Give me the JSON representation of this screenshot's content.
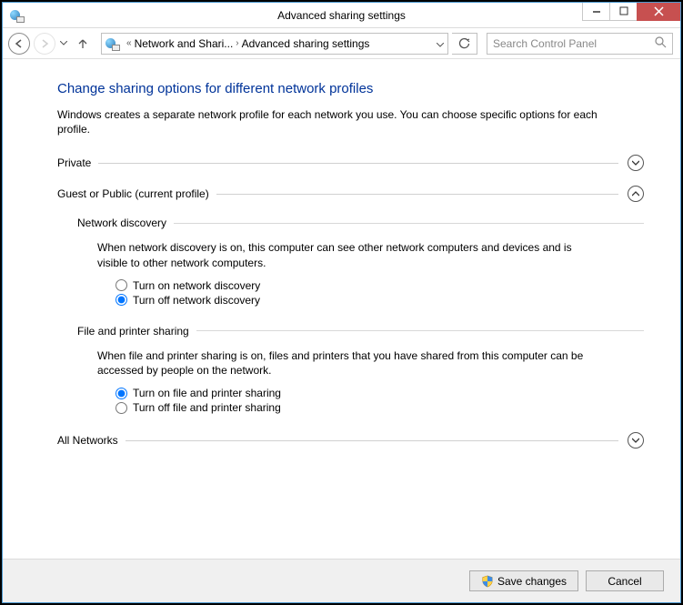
{
  "window": {
    "title": "Advanced sharing settings",
    "controls": {
      "min": "minimize",
      "max": "maximize",
      "close": "close"
    }
  },
  "breadcrumb": {
    "prefix": "«",
    "path1": "Network and Shari...",
    "path2": "Advanced sharing settings"
  },
  "search": {
    "placeholder": "Search Control Panel"
  },
  "heading": "Change sharing options for different network profiles",
  "intro": "Windows creates a separate network profile for each network you use. You can choose specific options for each profile.",
  "sections": {
    "private": {
      "label": "Private",
      "expanded": false
    },
    "guest": {
      "label": "Guest or Public (current profile)",
      "expanded": true,
      "net_discovery": {
        "title": "Network discovery",
        "desc": "When network discovery is on, this computer can see other network computers and devices and is visible to other network computers.",
        "opt_on": "Turn on network discovery",
        "opt_off": "Turn off network discovery",
        "selected": "off"
      },
      "file_share": {
        "title": "File and printer sharing",
        "desc": "When file and printer sharing is on, files and printers that you have shared from this computer can be accessed by people on the network.",
        "opt_on": "Turn on file and printer sharing",
        "opt_off": "Turn off file and printer sharing",
        "selected": "on"
      }
    },
    "all": {
      "label": "All Networks",
      "expanded": false
    }
  },
  "footer": {
    "save": "Save changes",
    "cancel": "Cancel"
  }
}
